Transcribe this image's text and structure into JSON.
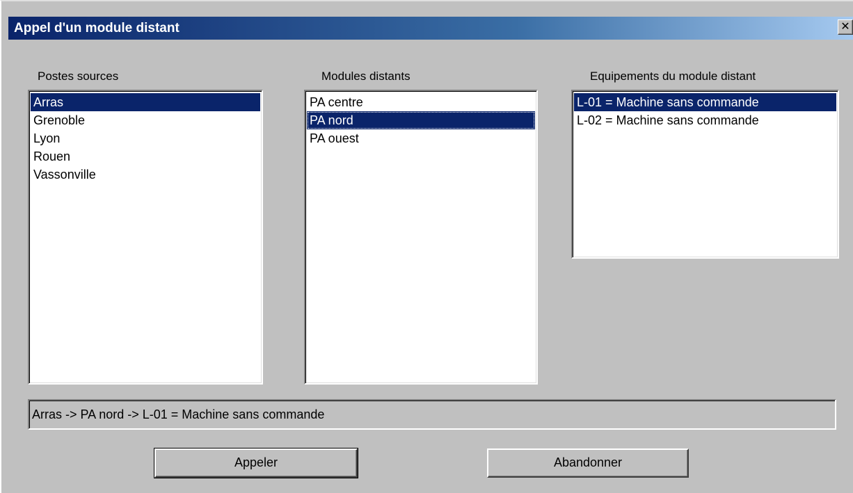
{
  "window": {
    "title": "Appel d'un module distant",
    "close_glyph": "✕"
  },
  "sources": {
    "label": "Postes sources",
    "items": [
      {
        "label": "Arras",
        "selected": true
      },
      {
        "label": "Grenoble",
        "selected": false
      },
      {
        "label": "Lyon",
        "selected": false
      },
      {
        "label": "Rouen",
        "selected": false
      },
      {
        "label": "Vassonville",
        "selected": false
      }
    ]
  },
  "modules": {
    "label": "Modules distants",
    "items": [
      {
        "label": "PA centre",
        "selected": false
      },
      {
        "label": "PA nord",
        "selected": true
      },
      {
        "label": "PA ouest",
        "selected": false
      }
    ]
  },
  "equipments": {
    "label": "Equipements du module distant",
    "items": [
      {
        "label": "L-01 = Machine sans commande",
        "selected": true
      },
      {
        "label": "L-02 = Machine sans commande",
        "selected": false
      }
    ]
  },
  "status": {
    "text": "Arras -> PA nord -> L-01 = Machine sans commande"
  },
  "buttons": {
    "call_label": "Appeler",
    "cancel_label": "Abandonner"
  },
  "colors": {
    "selection": "#0a246a",
    "titlebar_start": "#0a246a",
    "titlebar_end": "#a6caf0",
    "face": "#c0c0c0"
  }
}
